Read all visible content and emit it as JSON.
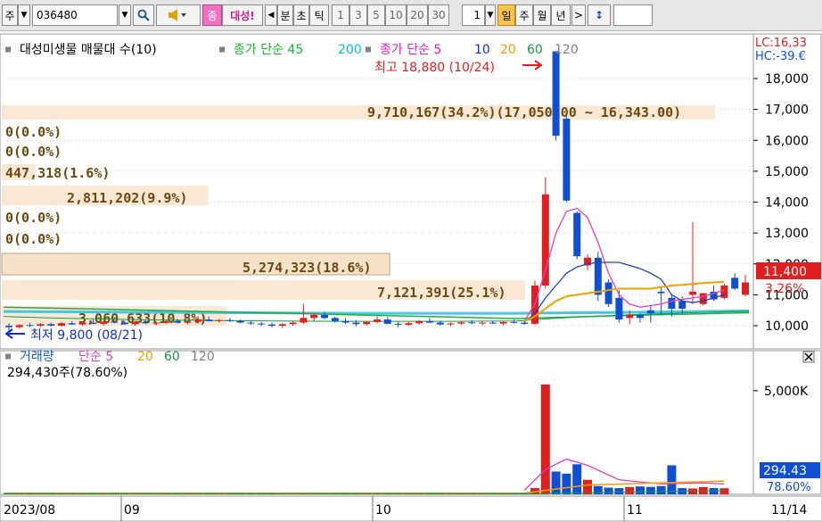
{
  "toolbar": {
    "market": "주",
    "code": "036480",
    "chart_type_label": "종",
    "name_short": "대성!",
    "period_nav_left": "◀",
    "period_labels": [
      "분",
      "초",
      "틱"
    ],
    "interval_labels": [
      "1",
      "3",
      "5",
      "10",
      "20",
      "30"
    ],
    "count_value": "1",
    "day_label": "일",
    "week_label": "주",
    "month_label": "월",
    "year_label": "년",
    "period_nav_right": ">",
    "updown_icon": "updown-arrow-icon",
    "search_icon": "magnifier-icon",
    "speaker_icon": "speaker-icon"
  },
  "legend_price": {
    "prefix": "■",
    "name": "대성미생물 매물대 수(10)",
    "ma_title": "종가 단순 45",
    "ma_200": "200",
    "ma2_title": "종가 단순 5",
    "ma2_10": "10",
    "ma2_20": "20",
    "ma2_60": "60",
    "ma2_120": "120",
    "colors": {
      "ma45": "#13b82f",
      "ma200": "#00c0e8",
      "ma5": "#e020c0",
      "ma10": "#1030d0",
      "ma20": "#f0a000",
      "ma60": "#10a040",
      "ma120": "#808080"
    }
  },
  "legend_volume": {
    "prefix": "■",
    "title": "거래량",
    "ma_title": "단순 5",
    "ma20": "20",
    "ma60": "60",
    "ma120": "120",
    "current": "294,430주(78.60%)"
  },
  "right_labels": {
    "lc": "LC:16,33",
    "hc": "HC:-39.€",
    "price_now": "11,400",
    "pct_now": "3.26%",
    "vol_now": "294.43",
    "vol_pct": "78.60%"
  },
  "annotations": {
    "high": "최고 18,880 (10/24)",
    "low": "최저 9,800 (08/21)"
  },
  "x_labels": [
    "2023/08",
    "09",
    "10",
    "11",
    "11/14"
  ],
  "y_labels_price": [
    "18,000",
    "17,000",
    "16,000",
    "15,000",
    "14,000",
    "13,000",
    "12,000",
    "11,000",
    "10,000"
  ],
  "y_labels_volume": [
    "5,000K"
  ],
  "chart_data": {
    "type": "bar",
    "title": "대성미생물 매물대 수(10)",
    "price_ylim": [
      9800,
      18880
    ],
    "volume_profile": [
      {
        "price_from": 16343.0,
        "price_to": 17050.0,
        "label": "9,710,167(34.2%)(17,050.00 ~ 16,343.00)",
        "volume": 9710167,
        "pct": 34.2
      },
      {
        "label": "0(0.0%)",
        "volume": 0,
        "pct": 0.0
      },
      {
        "label": "0(0.0%)",
        "volume": 0,
        "pct": 0.0
      },
      {
        "label": "447,318(1.6%)",
        "volume": 447318,
        "pct": 1.6
      },
      {
        "label": "2,811,202(9.9%)",
        "volume": 2811202,
        "pct": 9.9
      },
      {
        "label": "0(0.0%)",
        "volume": 0,
        "pct": 0.0
      },
      {
        "label": "0(0.0%)",
        "volume": 0,
        "pct": 0.0
      },
      {
        "label": "5,274,323(18.6%)",
        "volume": 5274323,
        "pct": 18.6
      },
      {
        "label": "7,121,391(25.1%)",
        "volume": 7121391,
        "pct": 25.1
      },
      {
        "label": "3,060,633(10.8%)",
        "volume": 3060633,
        "pct": 10.8
      }
    ],
    "candles": [
      {
        "o": 10000,
        "h": 10080,
        "l": 9800,
        "c": 9950
      },
      {
        "o": 9950,
        "h": 10050,
        "l": 9900,
        "c": 10020
      },
      {
        "o": 10020,
        "h": 10100,
        "l": 9960,
        "c": 10000
      },
      {
        "o": 10000,
        "h": 10080,
        "l": 9950,
        "c": 10050
      },
      {
        "o": 10050,
        "h": 10100,
        "l": 9980,
        "c": 10000
      },
      {
        "o": 10000,
        "h": 10120,
        "l": 9960,
        "c": 10080
      },
      {
        "o": 10080,
        "h": 10150,
        "l": 10020,
        "c": 10040
      },
      {
        "o": 10040,
        "h": 10120,
        "l": 9990,
        "c": 10100
      },
      {
        "o": 10100,
        "h": 10200,
        "l": 10050,
        "c": 10060
      },
      {
        "o": 10060,
        "h": 10150,
        "l": 10000,
        "c": 10130
      },
      {
        "o": 10130,
        "h": 10200,
        "l": 10080,
        "c": 10100
      },
      {
        "o": 10100,
        "h": 10160,
        "l": 10030,
        "c": 10050
      },
      {
        "o": 10050,
        "h": 10150,
        "l": 10000,
        "c": 10120
      },
      {
        "o": 10120,
        "h": 10180,
        "l": 10050,
        "c": 10080
      },
      {
        "o": 10080,
        "h": 10140,
        "l": 10020,
        "c": 10100
      },
      {
        "o": 10100,
        "h": 10200,
        "l": 10060,
        "c": 10150
      },
      {
        "o": 10150,
        "h": 10220,
        "l": 10080,
        "c": 10100
      },
      {
        "o": 10100,
        "h": 10180,
        "l": 10040,
        "c": 10130
      },
      {
        "o": 10130,
        "h": 10250,
        "l": 10080,
        "c": 10200
      },
      {
        "o": 10200,
        "h": 10300,
        "l": 10140,
        "c": 10150
      },
      {
        "o": 10150,
        "h": 10220,
        "l": 10100,
        "c": 10180
      },
      {
        "o": 10180,
        "h": 10250,
        "l": 10120,
        "c": 10150
      },
      {
        "o": 10150,
        "h": 10200,
        "l": 10080,
        "c": 10100
      },
      {
        "o": 10100,
        "h": 10160,
        "l": 10030,
        "c": 10070
      },
      {
        "o": 10070,
        "h": 10120,
        "l": 9990,
        "c": 10040
      },
      {
        "o": 10040,
        "h": 10100,
        "l": 9950,
        "c": 10000
      },
      {
        "o": 10000,
        "h": 10080,
        "l": 9930,
        "c": 10050
      },
      {
        "o": 10050,
        "h": 10150,
        "l": 10000,
        "c": 10100
      },
      {
        "o": 10100,
        "h": 10700,
        "l": 10060,
        "c": 10250
      },
      {
        "o": 10250,
        "h": 10400,
        "l": 10150,
        "c": 10350
      },
      {
        "o": 10350,
        "h": 10450,
        "l": 10200,
        "c": 10250
      },
      {
        "o": 10250,
        "h": 10300,
        "l": 10100,
        "c": 10150
      },
      {
        "o": 10150,
        "h": 10250,
        "l": 10050,
        "c": 10100
      },
      {
        "o": 10100,
        "h": 10180,
        "l": 9980,
        "c": 10050
      },
      {
        "o": 10050,
        "h": 10150,
        "l": 10000,
        "c": 10120
      },
      {
        "o": 10120,
        "h": 10300,
        "l": 10080,
        "c": 10200
      },
      {
        "o": 10200,
        "h": 10280,
        "l": 10050,
        "c": 10060
      },
      {
        "o": 10060,
        "h": 10140,
        "l": 9950,
        "c": 10030
      },
      {
        "o": 10030,
        "h": 10120,
        "l": 10000,
        "c": 10080
      },
      {
        "o": 10080,
        "h": 10180,
        "l": 10030,
        "c": 10150
      },
      {
        "o": 10150,
        "h": 10230,
        "l": 10080,
        "c": 10100
      },
      {
        "o": 10100,
        "h": 10160,
        "l": 10000,
        "c": 10040
      },
      {
        "o": 10040,
        "h": 10120,
        "l": 9980,
        "c": 10070
      },
      {
        "o": 10070,
        "h": 10150,
        "l": 10020,
        "c": 10110
      },
      {
        "o": 10110,
        "h": 10180,
        "l": 10050,
        "c": 10080
      },
      {
        "o": 10080,
        "h": 10140,
        "l": 10020,
        "c": 10100
      },
      {
        "o": 10100,
        "h": 10160,
        "l": 10050,
        "c": 10070
      },
      {
        "o": 10070,
        "h": 10140,
        "l": 10010,
        "c": 10120
      },
      {
        "o": 10120,
        "h": 10200,
        "l": 10070,
        "c": 10100
      },
      {
        "o": 10100,
        "h": 10160,
        "l": 10030,
        "c": 10060
      },
      {
        "o": 10060,
        "h": 11450,
        "l": 10020,
        "c": 11300
      },
      {
        "o": 11300,
        "h": 14800,
        "l": 11200,
        "c": 14250
      },
      {
        "o": 18880,
        "h": 18880,
        "l": 16000,
        "c": 16150
      },
      {
        "o": 16700,
        "h": 16800,
        "l": 14000,
        "c": 14050
      },
      {
        "o": 13650,
        "h": 13700,
        "l": 12150,
        "c": 12250
      },
      {
        "o": 11950,
        "h": 12300,
        "l": 11800,
        "c": 12200
      },
      {
        "o": 12200,
        "h": 12400,
        "l": 10800,
        "c": 11000
      },
      {
        "o": 11400,
        "h": 11500,
        "l": 10600,
        "c": 10700
      },
      {
        "o": 10900,
        "h": 11150,
        "l": 10100,
        "c": 10200
      },
      {
        "o": 10250,
        "h": 10500,
        "l": 10050,
        "c": 10350
      },
      {
        "o": 10350,
        "h": 10400,
        "l": 10100,
        "c": 10250
      },
      {
        "o": 10500,
        "h": 10650,
        "l": 10100,
        "c": 10400
      },
      {
        "o": 11100,
        "h": 11250,
        "l": 10350,
        "c": 11050
      },
      {
        "o": 10900,
        "h": 11000,
        "l": 10300,
        "c": 10550
      },
      {
        "o": 10800,
        "h": 10950,
        "l": 10400,
        "c": 10550
      },
      {
        "o": 11000,
        "h": 13350,
        "l": 10700,
        "c": 11100
      },
      {
        "o": 10700,
        "h": 11050,
        "l": 10650,
        "c": 11050
      },
      {
        "o": 11100,
        "h": 11300,
        "l": 10800,
        "c": 10850
      },
      {
        "o": 10900,
        "h": 11350,
        "l": 10850,
        "c": 11300
      },
      {
        "o": 11550,
        "h": 11700,
        "l": 11150,
        "c": 11200
      },
      {
        "o": 11000,
        "h": 11650,
        "l": 10950,
        "c": 11400
      }
    ],
    "volume": [
      40,
      35,
      30,
      38,
      32,
      36,
      30,
      34,
      38,
      32,
      30,
      36,
      34,
      30,
      32,
      36,
      34,
      30,
      38,
      35,
      32,
      34,
      30,
      32,
      30,
      28,
      32,
      36,
      60,
      45,
      40,
      36,
      34,
      32,
      34,
      40,
      38,
      32,
      30,
      34,
      36,
      32,
      30,
      34,
      32,
      30,
      32,
      34,
      30,
      32,
      300,
      5300,
      1100,
      1000,
      1450,
      700,
      400,
      320,
      300,
      350,
      380,
      360,
      400,
      1400,
      300,
      280,
      350,
      300,
      294
    ],
    "volume_ylim": [
      0,
      6500
    ]
  }
}
